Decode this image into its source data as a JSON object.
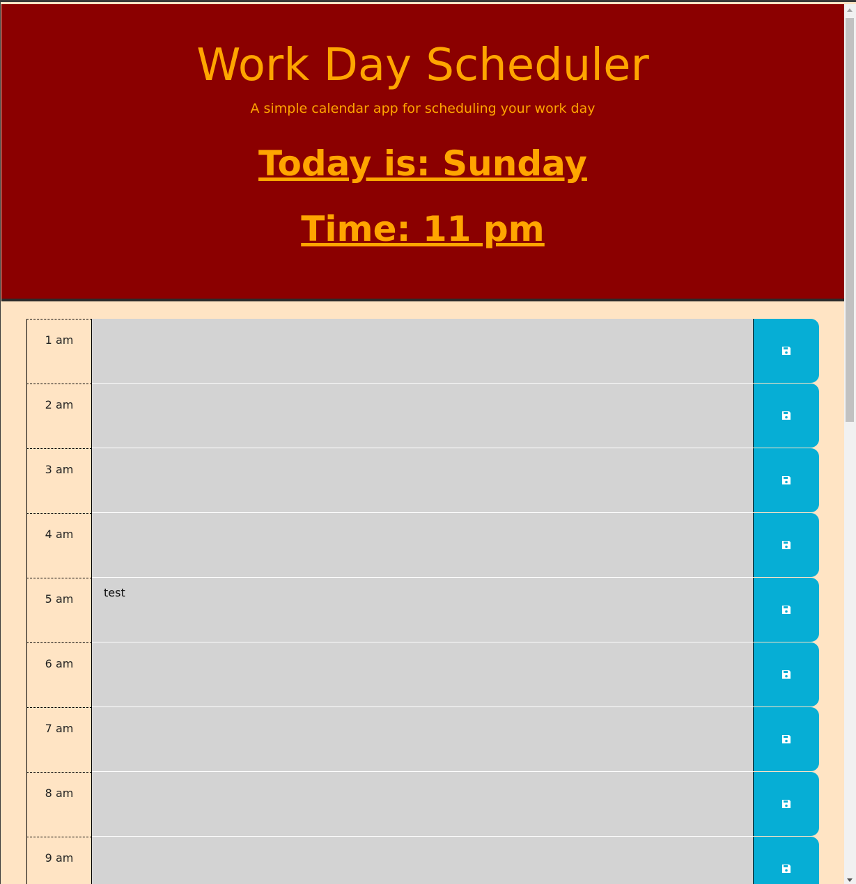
{
  "header": {
    "title": "Work Day Scheduler",
    "subtitle": "A simple calendar app for scheduling your work day",
    "today": "Today is: Sunday",
    "time": "Time: 11 pm"
  },
  "hours": [
    {
      "label": "1 am",
      "text": ""
    },
    {
      "label": "2 am",
      "text": ""
    },
    {
      "label": "3 am",
      "text": ""
    },
    {
      "label": "4 am",
      "text": ""
    },
    {
      "label": "5 am",
      "text": "test"
    },
    {
      "label": "6 am",
      "text": ""
    },
    {
      "label": "7 am",
      "text": ""
    },
    {
      "label": "8 am",
      "text": ""
    },
    {
      "label": "9 am",
      "text": ""
    }
  ],
  "icons": {
    "save": "floppy-disk-icon"
  },
  "colors": {
    "header_bg": "#8b0000",
    "header_text": "#ffa500",
    "page_bg": "#ffe4c4",
    "past_slot": "#d3d3d3",
    "save_button": "#06aed5"
  }
}
